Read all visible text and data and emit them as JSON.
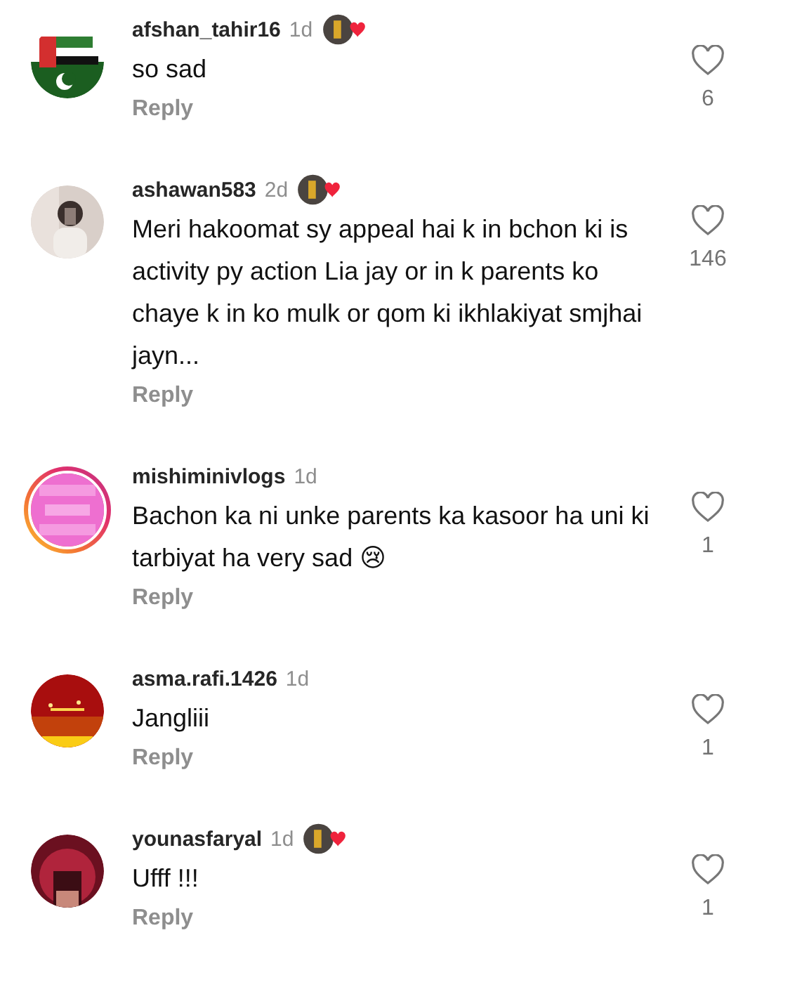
{
  "comments": [
    {
      "username": "afshan_tahir16",
      "time": "1d",
      "badge": true,
      "story_ring": false,
      "text": "so sad",
      "reply": "Reply",
      "likes": "6",
      "liked": false
    },
    {
      "username": "ashawan583",
      "time": "2d",
      "badge": true,
      "story_ring": false,
      "text": "Meri hakoomat sy appeal hai k in bchon ki is activity py action Lia jay or in k parents ko chaye k in ko mulk or qom ki ikhlakiyat smjhai jayn...",
      "reply": "Reply",
      "likes": "146",
      "liked": false
    },
    {
      "username": "mishiminivlogs",
      "time": "1d",
      "badge": false,
      "story_ring": true,
      "text": "Bachon ka ni unke parents ka kasoor ha uni ki tarbiyat ha very sad 😢",
      "reply": "Reply",
      "likes": "1",
      "liked": false
    },
    {
      "username": "asma.rafi.1426",
      "time": "1d",
      "badge": false,
      "story_ring": false,
      "text": "Jangliii",
      "reply": "Reply",
      "likes": "1",
      "liked": false
    },
    {
      "username": "younasfaryal",
      "time": "1d",
      "badge": true,
      "story_ring": false,
      "text": "Ufff !!!",
      "reply": "Reply",
      "likes": "1",
      "liked": false
    }
  ]
}
